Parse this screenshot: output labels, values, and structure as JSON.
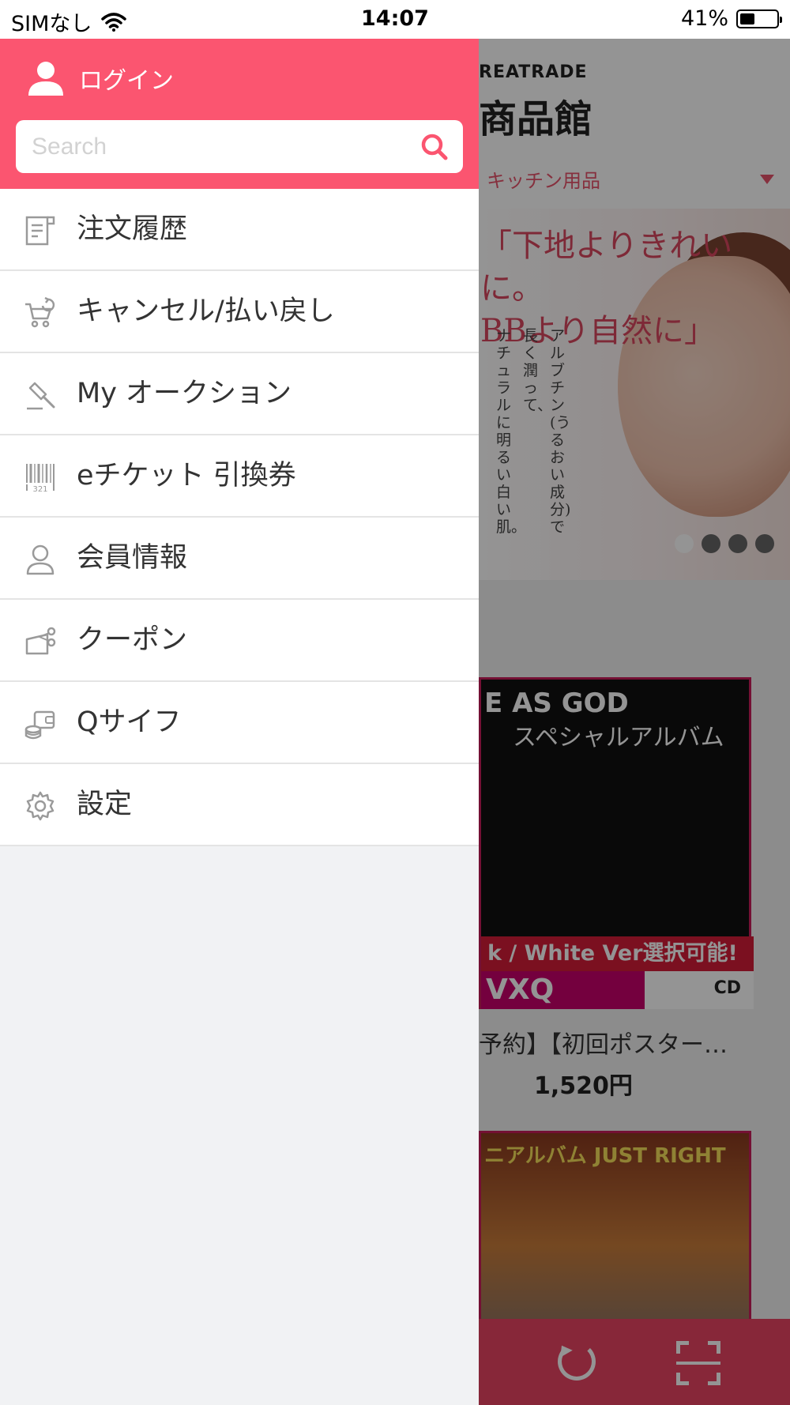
{
  "status_bar": {
    "carrier": "SIMなし",
    "time": "14:07",
    "battery_percent": "41%",
    "battery_level": 0.41
  },
  "drawer": {
    "login_label": "ログイン",
    "search_placeholder": "Search",
    "menu_items": [
      {
        "label": "注文履歴",
        "icon": "receipt-icon"
      },
      {
        "label": "キャンセル/払い戻し",
        "icon": "cart-return-icon"
      },
      {
        "label": "My オークション",
        "icon": "auction-gavel-icon"
      },
      {
        "label": "eチケット 引換券",
        "icon": "barcode-icon"
      },
      {
        "label": "会員情報",
        "icon": "person-icon"
      },
      {
        "label": "クーポン",
        "icon": "coupon-icon"
      },
      {
        "label": "Qサイフ",
        "icon": "wallet-icon"
      },
      {
        "label": "設定",
        "icon": "gear-icon"
      }
    ]
  },
  "background": {
    "brand_small": "REATRADE",
    "brand_big": "商品館",
    "category": "キッチン用品",
    "banner_headline_1": "「下地よりきれいに。",
    "banner_headline_2": "BBより自然に」",
    "banner_vertical_1": "アルブチン(うるおい成分)で",
    "banner_vertical_2": "長く潤って、",
    "banner_vertical_3": "ナチュラルに明るい白い肌。",
    "album1_title": "E AS GOD",
    "album1_subtitle": "スペシャルアルバム",
    "album1_band": "k / White Ver選択可能!",
    "album1_artist": "VXQ",
    "album1_badge": "CD",
    "product_name": "予約】【初回ポスター…",
    "product_price": "1,520円",
    "album2_title": "ニアルバム JUST RIGHT"
  },
  "colors": {
    "accent": "#fb5570",
    "drawer_bg": "#f1f2f4",
    "menu_text": "#333333",
    "icon_gray": "#9a9a9a"
  }
}
